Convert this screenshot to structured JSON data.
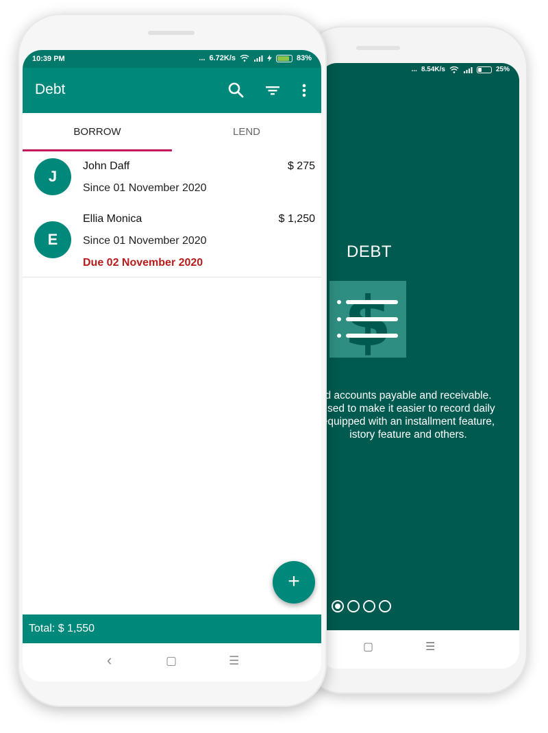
{
  "back_phone": {
    "status": {
      "dots": "...",
      "speed": "8.54K/s",
      "battery": "25%"
    },
    "onboarding": {
      "title": "DEBT",
      "description_lines": [
        "d accounts payable and receivable.",
        "used to make it easier to record daily",
        "equipped with an installment feature,",
        "istory feature and others."
      ],
      "pager_dots": 4,
      "active_dot": 0
    },
    "nav": {
      "home": "▢",
      "menu": "☰"
    }
  },
  "front_phone": {
    "status": {
      "time": "10:39 PM",
      "dots": "...",
      "speed": "6.72K/s",
      "battery": "83%"
    },
    "appbar": {
      "title": "Debt"
    },
    "tabs": [
      {
        "label": "BORROW",
        "active": true
      },
      {
        "label": "LEND",
        "active": false
      }
    ],
    "items": [
      {
        "initial": "J",
        "name": "John Daff",
        "amount": "$ 275",
        "since": "Since 01 November 2020",
        "due": ""
      },
      {
        "initial": "E",
        "name": "Ellia Monica",
        "amount": "$ 1,250",
        "since": "Since 01 November 2020",
        "due": "Due 02 November 2020"
      }
    ],
    "fab_label": "+",
    "total": "Total: $ 1,550",
    "nav": {
      "back": "‹",
      "home": "▢",
      "menu": "☰"
    }
  },
  "colors": {
    "primary": "#00897b",
    "status": "#00796b",
    "accent": "#c2185b",
    "onboarding_bg": "#005a4f",
    "due": "#b71c1c"
  }
}
